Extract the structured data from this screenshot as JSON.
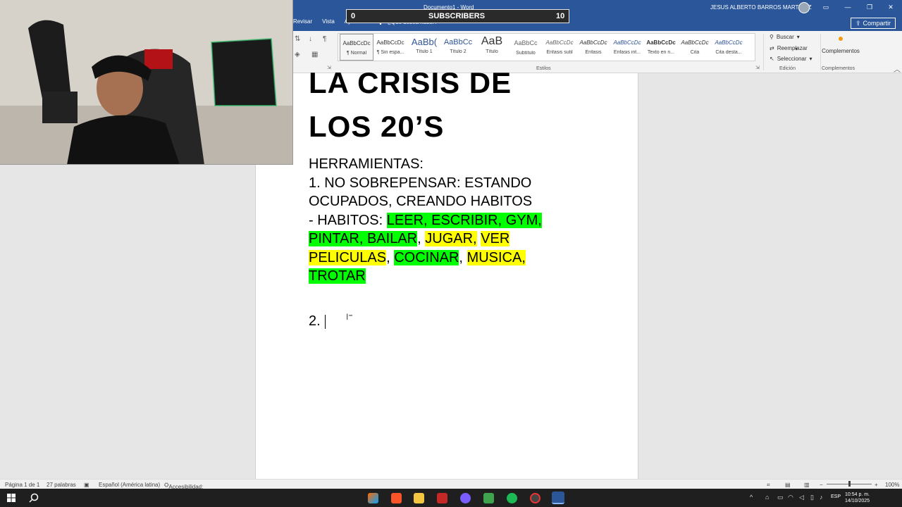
{
  "window": {
    "doc_title": "Documento1 - Word",
    "user_name": "JESUS ALBERTO BARROS MARTINEZ",
    "share_label": "Compartir",
    "tell_me_placeholder": "¿Qué desea hacer?",
    "accent": "#2b579a"
  },
  "ribbon_tabs": [
    "Revisar",
    "Vista",
    "Ayuda"
  ],
  "overlay": {
    "subs_left": "0",
    "subs_label": "SUBSCRIBERS",
    "subs_right": "10"
  },
  "styles": [
    {
      "preview": "AaBbCcDc",
      "label": "¶ Normal"
    },
    {
      "preview": "AaBbCcDc",
      "label": "¶ Sin espa..."
    },
    {
      "preview": "AaBb(",
      "label": "Título 1"
    },
    {
      "preview": "AaBbCc",
      "label": "Título 2"
    },
    {
      "preview": "AaB",
      "label": "Título"
    },
    {
      "preview": "AaBbCc",
      "label": "Subtítulo"
    },
    {
      "preview": "AaBbCcDc",
      "label": "Énfasis sutil"
    },
    {
      "preview": "AaBbCcDc",
      "label": "Énfasis"
    },
    {
      "preview": "AaBbCcDc",
      "label": "Énfasis int..."
    },
    {
      "preview": "AaBbCcDc",
      "label": "Texto en n..."
    },
    {
      "preview": "AaBbCcDc",
      "label": "Cita"
    },
    {
      "preview": "AaBbCcDc",
      "label": "Cita desta..."
    }
  ],
  "groups": {
    "styles": "Estilos",
    "editing": "Edición",
    "addins": "Complementos"
  },
  "editing": {
    "find": "Buscar",
    "replace": "Reemplazar",
    "select": "Seleccionar"
  },
  "addins_button": "Complementos",
  "document": {
    "title_line1": "LA CRISIS DE",
    "title_line2": "LOS 20’S",
    "heading": "HERRAMIENTAS:",
    "item1_line1": "1. NO SOBREPENSAR: ESTANDO",
    "item1_line2": "OCUPADOS, CREANDO HABITOS",
    "habits_prefix": "- HABITOS: ",
    "habit_green1": "LEER, ESCRIBIR, GYM,",
    "habit_green2": "PINTAR, BAILAR",
    "habit_yellow1": "JUGAR,",
    "habit_yellow2": "VER",
    "habit_yellow3": "PELICULAS",
    "habit_green3": "COCINAR",
    "habit_yellow4": "MUSICA,",
    "habit_green4": "TROTAR",
    "sep_comma": ", ",
    "item2": "2."
  },
  "status": {
    "page": "Página 1 de 1",
    "words": "27 palabras",
    "language": "Español (América latina)",
    "accessibility": "Accesibilidad: todo correcto",
    "zoom": "100%"
  },
  "taskbar": {
    "lang": "ESP",
    "time": "10:54 p. m.",
    "date": "14/10/2025"
  }
}
